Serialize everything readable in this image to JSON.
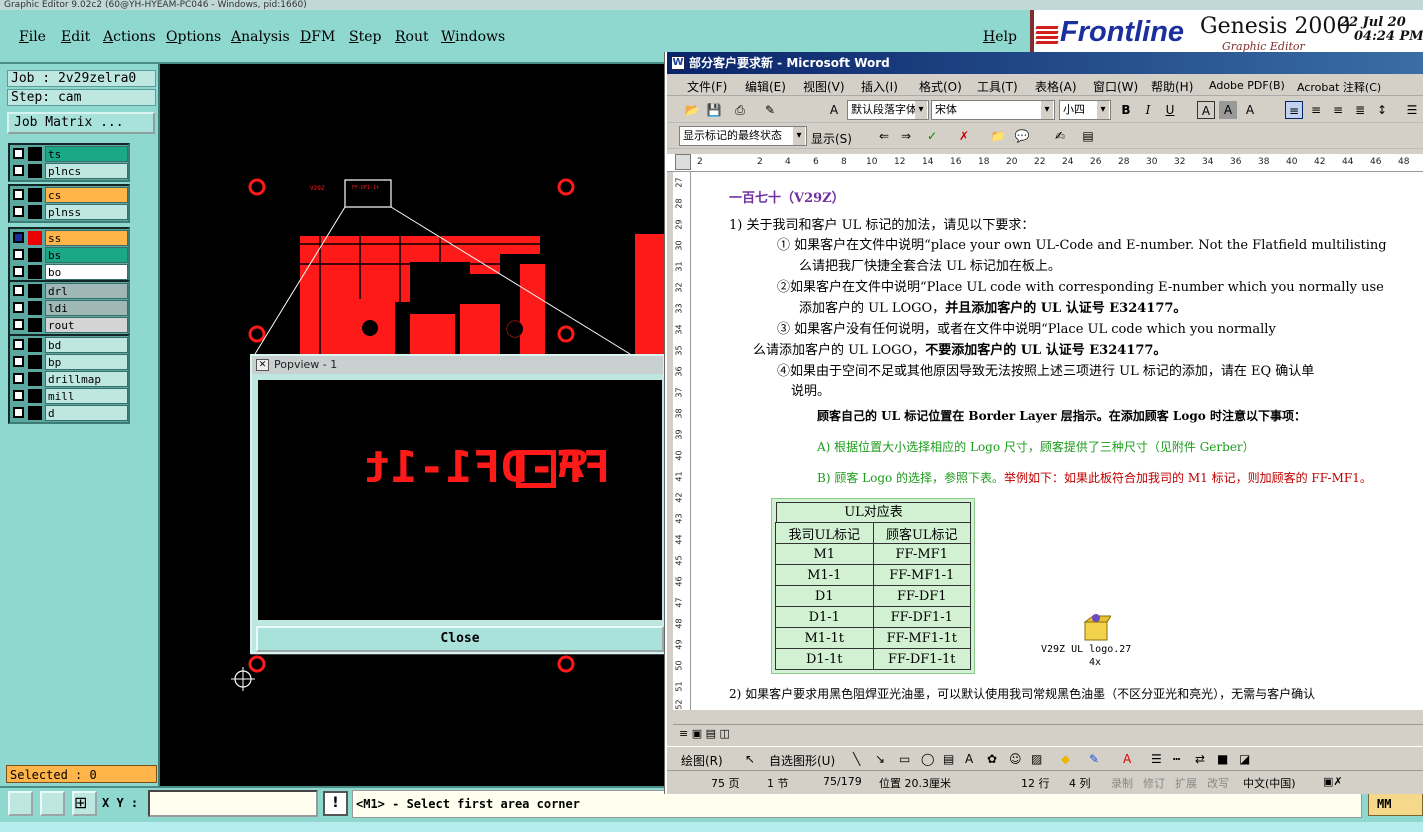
{
  "genesis": {
    "window_title": "Graphic Editor 9.02c2 (60@YH-HYEAM-PC046 - Windows, pid:1660)",
    "menu": [
      "File",
      "Edit",
      "Actions",
      "Options",
      "Analysis",
      "DFM",
      "Step",
      "Rout",
      "Windows"
    ],
    "help": "Help",
    "logo": "Frontline",
    "product": "Genesis 2000",
    "subtitle": "Graphic Editor",
    "date": "22 Jul 20",
    "time": "04:24 PM",
    "job": "Job : 2v29zelra0",
    "step": "Step: cam",
    "job_matrix": "Job Matrix ...",
    "layers": [
      {
        "name": "ts",
        "color": "#1aa886",
        "checked": false
      },
      {
        "name": "plncs",
        "color": "#bfe7e2",
        "checked": false
      },
      {
        "name": "cs",
        "color": "#ffb54a",
        "checked": false
      },
      {
        "name": "plnss",
        "color": "#bfe7e2",
        "checked": false
      },
      {
        "name": "ss",
        "color": "#ffb54a",
        "checked": true
      },
      {
        "name": "bs",
        "color": "#1aa886",
        "checked": false
      },
      {
        "name": "bo",
        "color": "#ffffff",
        "checked": false
      },
      {
        "name": "drl",
        "color": "#9fb7b5",
        "checked": false
      },
      {
        "name": "ldi",
        "color": "#9fb7b5",
        "checked": false
      },
      {
        "name": "rout",
        "color": "#d4d4d4",
        "checked": false
      },
      {
        "name": "bd",
        "color": "#bfe7e2",
        "checked": false
      },
      {
        "name": "bp",
        "color": "#bfe7e2",
        "checked": false
      },
      {
        "name": "drillmap",
        "color": "#bfe7e2",
        "checked": false
      },
      {
        "name": "mill",
        "color": "#bfe7e2",
        "checked": false
      },
      {
        "name": "d",
        "color": "#bfe7e2",
        "checked": false
      }
    ],
    "selected": "Selected : 0",
    "xy_label": "X Y :",
    "xy_value": "",
    "status": "<M1> - Select first area corner",
    "units": "MM",
    "popview": {
      "title": "Popview - 1",
      "close": "Close",
      "preview_text": "FF-DF1-1t",
      "preview_mirror": "tI-IFD-FF"
    }
  },
  "word": {
    "title": "部分客户要求新 - Microsoft Word",
    "menu": [
      "文件(F)",
      "编辑(E)",
      "视图(V)",
      "插入(I)",
      "格式(O)",
      "工具(T)",
      "表格(A)",
      "窗口(W)",
      "帮助(H)",
      "Adobe PDF(B)",
      "Acrobat 注释(C)"
    ],
    "style_combo": "默认段落字体",
    "font_combo": "宋体",
    "size_combo": "小四",
    "markup_combo": "显示标记的最终状态",
    "show_button": "显示(S)",
    "doc": {
      "heading": "一百七十（V29Z）",
      "l1": "1) 关于我司和客户 UL 标记的加法，请见以下要求：",
      "l2": "① 如果客户在文件中说明“place your own UL-Code and E-number. Not the Flatfield multilisting",
      "l3": "么请把我厂快捷全套合法 UL 标记加在板上。",
      "l4": "②如果客户在文件中说明“Place UL code with corresponding E-number which you normally use",
      "l5a": "添加客户的 UL LOGO，",
      "l5b": "并且添加客户的 UL 认证号 E324177。",
      "l6": "③  如果客户没有任何说明，或者在文件中说明“Place UL code which you normally",
      "l7a": "么请添加客户的 UL LOGO，",
      "l7b": "不要添加客户的 UL 认证号 E324177。",
      "l8": "④如果由于空间不足或其他原因导致无法按照上述三项进行 UL 标记的添加，请在 EQ 确认单",
      "l9": "说明。",
      "l10": "顾客自己的 UL 标记位置在 Border  Layer 层指示。在添加顾客 Logo 时注意以下事项：",
      "l11": "A) 根据位置大小选择相应的 Logo 尺寸，顾客提供了三种尺寸（见附件 Gerber）",
      "l12a": "B) 顾客 Logo 的选择，参照下表。",
      "l12b": "举例如下：如果此板符合加我司的 M1 标记，则加顾客的 FF-MF1。",
      "l13": "2)  如果客户要求用黑色阻焊亚光油墨，可以默认使用我司常规黑色油墨（不区分亚光和亮光），无需与客户确认"
    },
    "table": {
      "caption": "UL对应表",
      "headers": [
        "我司UL标记",
        "顾客UL标记"
      ],
      "rows": [
        [
          "M1",
          "FF-MF1"
        ],
        [
          "M1-1",
          "FF-MF1-1"
        ],
        [
          "D1",
          "FF-DF1"
        ],
        [
          "D1-1",
          "FF-DF1-1"
        ],
        [
          "M1-1t",
          "FF-MF1-1t"
        ],
        [
          "D1-1t",
          "FF-DF1-1t"
        ]
      ]
    },
    "object_label": "V29Z  UL  logo.27",
    "object_sub": "4x",
    "draw_label": "绘图(R)",
    "autoshape_label": "自选图形(U)",
    "status": {
      "page": "75 页",
      "section": "1 节",
      "pages": "75/179",
      "pos": "位置 20.3厘米",
      "line": "12 行",
      "col": "4 列",
      "rec": "录制",
      "rev": "修订",
      "ext": "扩展",
      "ovr": "改写",
      "lang": "中文(中国)"
    },
    "ruler_nums": [
      "2",
      "2",
      "4",
      "6",
      "8",
      "10",
      "12",
      "14",
      "16",
      "18",
      "20",
      "22",
      "24",
      "26",
      "28",
      "30",
      "32",
      "34",
      "36",
      "38",
      "40",
      "42",
      "44",
      "46",
      "48"
    ],
    "vruler_nums": [
      "27",
      "28",
      "29",
      "30",
      "31",
      "32",
      "33",
      "34",
      "35",
      "36",
      "37",
      "38",
      "39",
      "40",
      "41",
      "42",
      "43",
      "44",
      "45",
      "46",
      "47",
      "48",
      "49",
      "50",
      "51",
      "52"
    ]
  }
}
